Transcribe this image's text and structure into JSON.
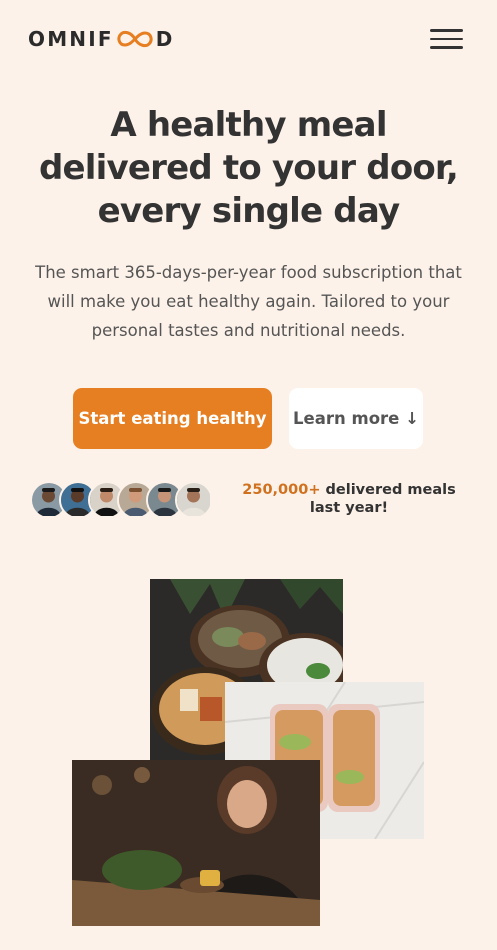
{
  "header": {
    "logo_left": "OMNIF",
    "logo_right": "D",
    "menu_icon": "hamburger-menu-icon"
  },
  "hero": {
    "title_line1": "A healthy meal",
    "title_line2": "delivered to your door,",
    "title_line3": "every single day",
    "description": "The smart 365-days-per-year food subscription that will make you eat healthy again. Tailored to your personal tastes and nutritional needs.",
    "primary_button": "Start eating healthy",
    "secondary_button": "Learn more ↓"
  },
  "social_proof": {
    "count": "250,000+",
    "text": " delivered meals last year!",
    "avatar_count": 6
  },
  "colors": {
    "background": "#fdf2e9",
    "accent": "#e67e22",
    "accent_text": "#cf711f",
    "text": "#333333"
  }
}
